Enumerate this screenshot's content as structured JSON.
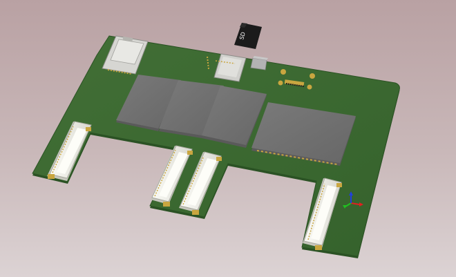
{
  "viewer": {
    "background_top": "#b9a1a3",
    "background_bottom": "#dcd3d4"
  },
  "board": {
    "pcb_color": "#3c6b32",
    "pcb_edge_color": "#2b5224",
    "module_color": "#6f6f6f",
    "connector_body_color": "#efefe9",
    "contact_color": "#c9a640"
  },
  "sd_card": {
    "label": "SD"
  },
  "axis_triad": {
    "x_color": "#e02020",
    "y_color": "#20c020",
    "z_color": "#2040e0"
  }
}
